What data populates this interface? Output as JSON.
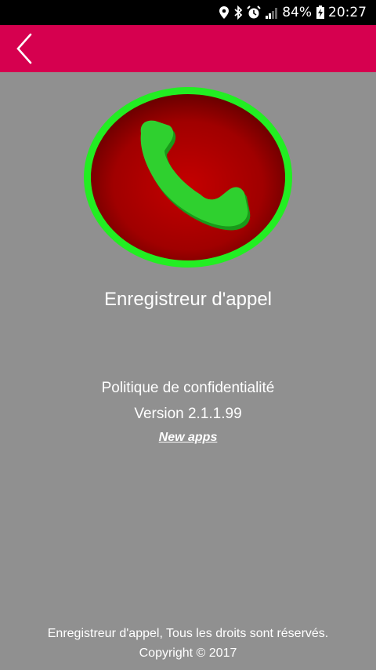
{
  "status_bar": {
    "battery": "84%",
    "time": "20:27",
    "icons": [
      "location-icon",
      "bluetooth-icon",
      "alarm-icon",
      "signal-icon",
      "battery-icon"
    ]
  },
  "app_bar": {
    "color": "#d6004f",
    "back_icon": "chevron-left-icon"
  },
  "logo": {
    "icon": "phone-icon",
    "ring_color": "#22ee22",
    "disc_color": "#a00000",
    "handset_color": "#22cc22"
  },
  "main": {
    "app_name": "Enregistreur d'appel",
    "privacy_label": "Politique de confidentialité",
    "version_label": "Version 2.1.1.99",
    "new_apps_label": "New apps"
  },
  "footer": {
    "rights": "Enregistreur d'appel, Tous les droits sont réservés.",
    "copyright": "Copyright © 2017"
  }
}
